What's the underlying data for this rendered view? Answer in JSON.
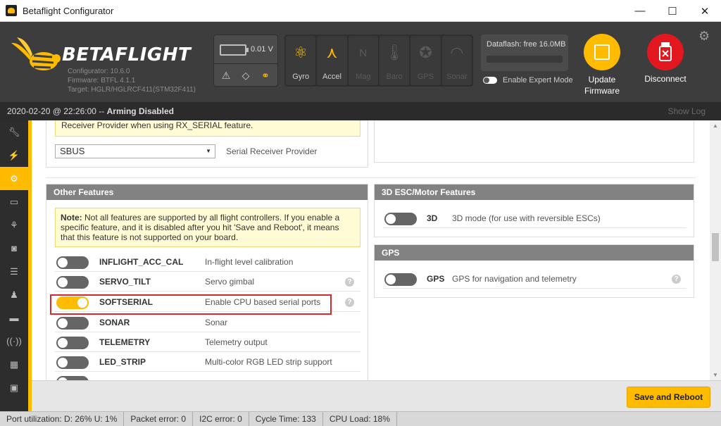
{
  "window": {
    "title": "Betaflight Configurator",
    "minimize": "—",
    "maximize": "☐",
    "close": "✕"
  },
  "header": {
    "logo_text": "BETAFLIGHT",
    "configurator_version": "Configurator: 10.6.0",
    "firmware": "Firmware: BTFL 4.1.1",
    "target": "Target: HGLR/HGLRCF411(STM32F411)",
    "voltage": "0.01 V",
    "sensors": [
      {
        "label": "Gyro",
        "icon": "gyro-icon",
        "active": true
      },
      {
        "label": "Accel",
        "icon": "accel-icon",
        "active": true
      },
      {
        "label": "Mag",
        "icon": "mag-icon",
        "active": false
      },
      {
        "label": "Baro",
        "icon": "baro-icon",
        "active": false
      },
      {
        "label": "GPS",
        "icon": "gps-icon",
        "active": false
      },
      {
        "label": "Sonar",
        "icon": "sonar-icon",
        "active": false
      }
    ],
    "dataflash": "Dataflash: free 16.0MB",
    "expert_mode": "Enable Expert Mode",
    "update_firmware_line1": "Update",
    "update_firmware_line2": "Firmware",
    "disconnect": "Disconnect"
  },
  "status": {
    "timestamp": "2020-02-20 @ 22:26:00 -- ",
    "arming": "Arming Disabled",
    "show_log": "Show Log"
  },
  "receiver": {
    "note": "Receiver Provider when using RX_SERIAL feature.",
    "provider_value": "SBUS",
    "provider_label": "Serial Receiver Provider"
  },
  "other_features": {
    "title": "Other Features",
    "note_bold": "Note:",
    "note_text": " Not all features are supported by all flight controllers. If you enable a specific feature, and it is disabled after you hit 'Save and Reboot', it means that this feature is not supported on your board.",
    "features": [
      {
        "name": "INFLIGHT_ACC_CAL",
        "desc": "In-flight level calibration",
        "on": false,
        "help": false
      },
      {
        "name": "SERVO_TILT",
        "desc": "Servo gimbal",
        "on": false,
        "help": true
      },
      {
        "name": "SOFTSERIAL",
        "desc": "Enable CPU based serial ports",
        "on": true,
        "help": true
      },
      {
        "name": "SONAR",
        "desc": "Sonar",
        "on": false,
        "help": false
      },
      {
        "name": "TELEMETRY",
        "desc": "Telemetry output",
        "on": false,
        "help": false
      },
      {
        "name": "LED_STRIP",
        "desc": "Multi-color RGB LED strip support",
        "on": false,
        "help": false
      }
    ]
  },
  "esc_features": {
    "title": "3D ESC/Motor Features",
    "name": "3D",
    "desc": "3D mode (for use with reversible ESCs)"
  },
  "gps": {
    "title": "GPS",
    "name": "GPS",
    "desc": "GPS for navigation and telemetry"
  },
  "save_button": "Save and Reboot",
  "footer": {
    "port_util": "Port utilization: D: 26% U: 1%",
    "packet_error": "Packet error: 0",
    "i2c_error": "I2C error: 0",
    "cycle_time": "Cycle Time: 133",
    "cpu_load": "CPU Load: 18%"
  },
  "colors": {
    "accent": "#ffbb00",
    "disconnect": "#e2171f",
    "header_bg": "#3d3d3d",
    "highlight": "#d9272e"
  }
}
